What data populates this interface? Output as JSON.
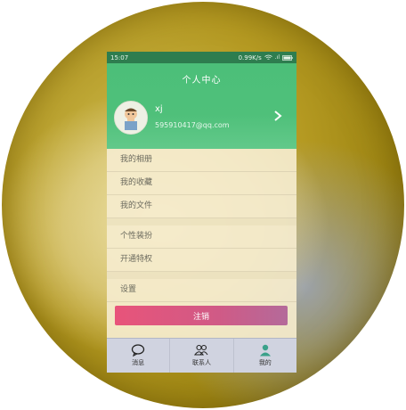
{
  "status": {
    "time": "15:07",
    "speed": "0.99K/s"
  },
  "header": {
    "title": "个人中心"
  },
  "profile": {
    "name": "xj",
    "email": "595910417@qq.com"
  },
  "menu": {
    "group1": [
      "我的相册",
      "我的收藏",
      "我的文件"
    ],
    "group2": [
      "个性装扮",
      "开通特权"
    ],
    "group3": [
      "设置"
    ]
  },
  "logout_label": "注销",
  "tabs": [
    {
      "label": "消息",
      "icon": "message-icon"
    },
    {
      "label": "联系人",
      "icon": "contacts-icon"
    },
    {
      "label": "我的",
      "icon": "profile-icon",
      "active": true
    }
  ],
  "colors": {
    "accent": "#4cbf79",
    "logout": "#e8547a",
    "active_tab": "#3aa18a"
  }
}
